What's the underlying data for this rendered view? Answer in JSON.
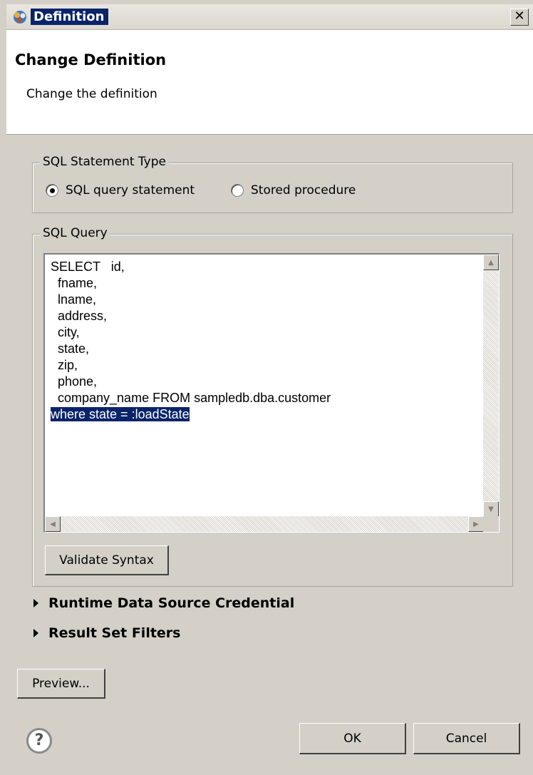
{
  "window": {
    "title": "Definition",
    "close_glyph": "✕"
  },
  "header": {
    "title": "Change Definition",
    "subtitle": "Change the definition"
  },
  "statement_type": {
    "legend": "SQL Statement Type",
    "options": [
      {
        "label": "SQL query statement",
        "selected": true
      },
      {
        "label": "Stored procedure",
        "selected": false
      }
    ]
  },
  "sql_query": {
    "legend": "SQL Query",
    "lines": [
      "SELECT   id,",
      "  fname,",
      "  lname,",
      "  address,",
      "  city,",
      "  state,",
      "  zip,",
      "  phone,",
      "  company_name FROM sampledb.dba.customer",
      "where state = :loadState"
    ],
    "selected_line_index": 9,
    "validate_button": "Validate Syntax"
  },
  "sections": [
    {
      "label": "Runtime Data Source Credential"
    },
    {
      "label": "Result Set Filters"
    }
  ],
  "buttons": {
    "preview": "Preview...",
    "ok": "OK",
    "cancel": "Cancel"
  },
  "help": {
    "glyph": "?"
  },
  "colors": {
    "selection": "#0a246a",
    "dialog_bg": "#d4d0c8"
  }
}
